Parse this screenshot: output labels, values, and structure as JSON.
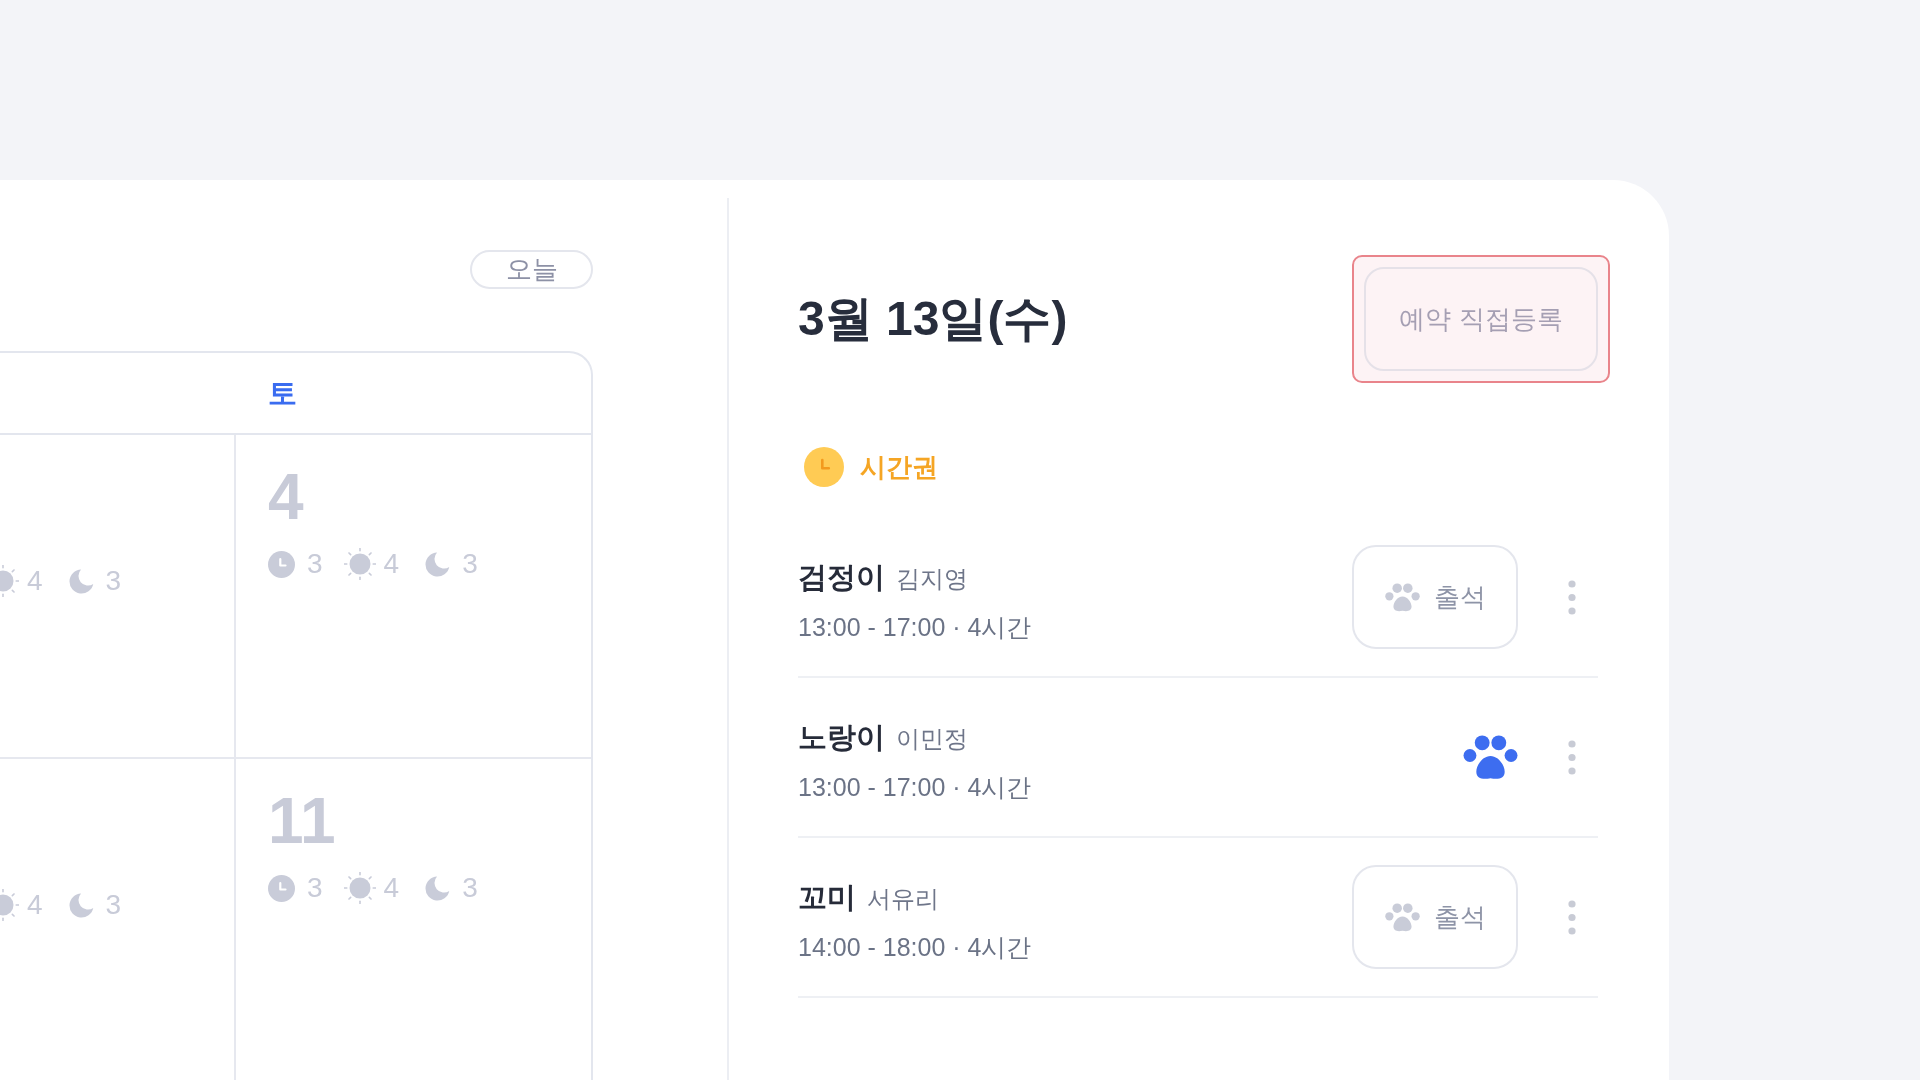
{
  "calendar": {
    "today_button": "오늘",
    "weekday_headers": [
      {
        "label": "토",
        "kind": "saturday"
      }
    ],
    "weeks": [
      {
        "days": [
          {
            "counts": [
              {
                "kind": "day",
                "value": "4"
              },
              {
                "kind": "night",
                "value": "3"
              }
            ]
          },
          {
            "date": "4",
            "counts": [
              {
                "kind": "hourly",
                "value": "3"
              },
              {
                "kind": "day",
                "value": "4"
              },
              {
                "kind": "night",
                "value": "3"
              }
            ]
          }
        ]
      },
      {
        "days": [
          {
            "counts": [
              {
                "kind": "day",
                "value": "4"
              },
              {
                "kind": "night",
                "value": "3"
              }
            ]
          },
          {
            "date": "11",
            "counts": [
              {
                "kind": "hourly",
                "value": "3"
              },
              {
                "kind": "day",
                "value": "4"
              },
              {
                "kind": "night",
                "value": "3"
              }
            ]
          }
        ]
      }
    ]
  },
  "schedule": {
    "title": "3월 13일(수)",
    "register_button": {
      "label": "예약 직접등록",
      "highlighted": true
    },
    "sections": [
      {
        "label": "시간권",
        "kind": "hourly",
        "reservations": [
          {
            "pet": "검정이",
            "owner": "김지영",
            "time": "13:00 - 17:00 · 4시간",
            "attended": false,
            "attend_label": "출석"
          },
          {
            "pet": "노랑이",
            "owner": "이민정",
            "time": "13:00 - 17:00 · 4시간",
            "attended": true
          },
          {
            "pet": "꼬미",
            "owner": "서유리",
            "time": "14:00 - 18:00 · 4시간",
            "attended": false,
            "attend_label": "출석"
          }
        ]
      }
    ]
  }
}
